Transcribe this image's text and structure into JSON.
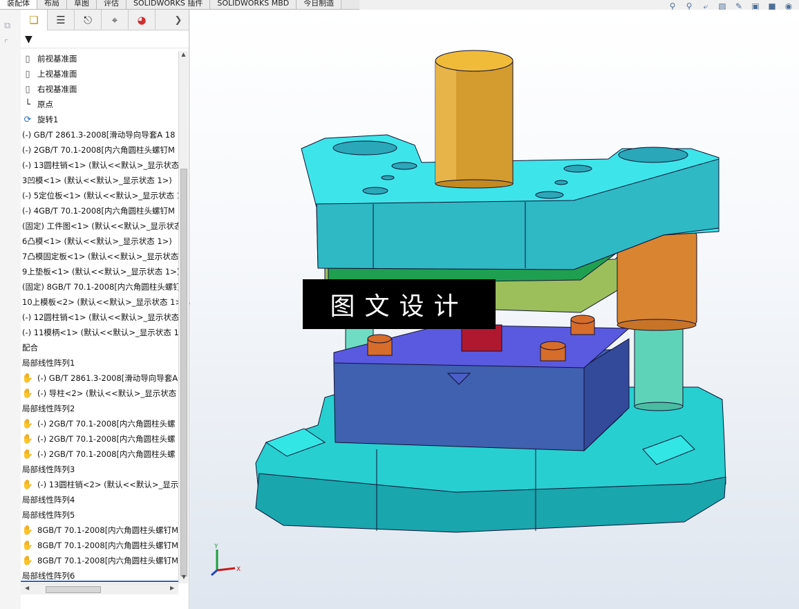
{
  "tabs": [
    {
      "label": "装配体",
      "active": true
    },
    {
      "label": "布局",
      "active": false
    },
    {
      "label": "草图",
      "active": false
    },
    {
      "label": "评估",
      "active": false
    },
    {
      "label": "SOLIDWORKS 插件",
      "active": false
    },
    {
      "label": "SOLIDWORKS MBD",
      "active": false
    },
    {
      "label": "今日制造",
      "active": false
    }
  ],
  "hud_icons": [
    "zoom-to-fit-icon",
    "zoom-area-icon",
    "previous-view-icon",
    "section-view-icon",
    "dynamic-annotation-icon",
    "view-orientation-icon",
    "display-style-icon",
    "hide-show-icon"
  ],
  "feature_manager": {
    "tab_icons": [
      "feature-manager-icon",
      "property-manager-icon",
      "configuration-manager-icon",
      "dimxpert-icon",
      "display-manager-icon"
    ],
    "tree": [
      {
        "icon": "plane",
        "label": "前视基准面"
      },
      {
        "icon": "plane",
        "label": "上视基准面"
      },
      {
        "icon": "plane",
        "label": "右视基准面"
      },
      {
        "icon": "origin",
        "label": "原点"
      },
      {
        "icon": "revolve",
        "label": "旋转1"
      },
      {
        "icon": "",
        "label": "(-) GB/T 2861.3-2008[滑动导向导套A 18"
      },
      {
        "icon": "",
        "label": "(-) 2GB/T 70.1-2008[内六角圆柱头螺钉M"
      },
      {
        "icon": "",
        "label": "(-) 13圆柱销<1> (默认<<默认>_显示状态"
      },
      {
        "icon": "",
        "label": "3凹模<1> (默认<<默认>_显示状态 1>)"
      },
      {
        "icon": "",
        "label": "(-) 5定位板<1> (默认<<默认>_显示状态 1"
      },
      {
        "icon": "",
        "label": "(-) 4GB/T 70.1-2008[内六角圆柱头螺钉M"
      },
      {
        "icon": "",
        "label": "(固定) 工件图<1> (默认<<默认>_显示状态"
      },
      {
        "icon": "",
        "label": "6凸模<1> (默认<<默认>_显示状态 1>)"
      },
      {
        "icon": "",
        "label": "7凸模固定板<1> (默认<<默认>_显示状态"
      },
      {
        "icon": "",
        "label": "9上垫板<1> (默认<<默认>_显示状态 1>)"
      },
      {
        "icon": "",
        "label": "(固定) 8GB/T 70.1-2008[内六角圆柱头螺钉"
      },
      {
        "icon": "",
        "label": "10上模板<2> (默认<<默认>_显示状态 1>)"
      },
      {
        "icon": "",
        "label": "(-) 12圆柱销<1> (默认<<默认>_显示状态"
      },
      {
        "icon": "",
        "label": "(-) 11模柄<1> (默认<<默认>_显示状态 1"
      },
      {
        "icon": "",
        "label": "配合"
      },
      {
        "icon": "",
        "label": "局部线性阵列1"
      },
      {
        "icon": "pattern",
        "label": "(-) GB/T 2861.3-2008[滑动导向导套A"
      },
      {
        "icon": "pattern",
        "label": "(-) 导柱<2> (默认<<默认>_显示状态"
      },
      {
        "icon": "",
        "label": "局部线性阵列2"
      },
      {
        "icon": "pattern",
        "label": "(-) 2GB/T 70.1-2008[内六角圆柱头螺"
      },
      {
        "icon": "pattern",
        "label": "(-) 2GB/T 70.1-2008[内六角圆柱头螺"
      },
      {
        "icon": "pattern",
        "label": "(-) 2GB/T 70.1-2008[内六角圆柱头螺"
      },
      {
        "icon": "",
        "label": "局部线性阵列3"
      },
      {
        "icon": "pattern",
        "label": "(-) 13圆柱销<2> (默认<<默认>_显示"
      },
      {
        "icon": "",
        "label": "局部线性阵列4"
      },
      {
        "icon": "",
        "label": "局部线性阵列5"
      },
      {
        "icon": "pattern",
        "label": "8GB/T 70.1-2008[内六角圆柱头螺钉M"
      },
      {
        "icon": "pattern",
        "label": "8GB/T 70.1-2008[内六角圆柱头螺钉M"
      },
      {
        "icon": "pattern",
        "label": "8GB/T 70.1-2008[内六角圆柱头螺钉M"
      },
      {
        "icon": "",
        "label": "局部线性阵列6"
      }
    ]
  },
  "viewport": {
    "watermark": "图文设计",
    "triad": {
      "y": "Y",
      "x": "X"
    }
  },
  "colors": {
    "die_base": "#2ee6e6",
    "punch_holder": "#7ed957",
    "die_plate": "#3e5fae",
    "stripper": "#5a5ad8",
    "shank": "#d79a28",
    "bushing": "#e08a3a",
    "guide_pillar": "#5fd3b8",
    "punch": "#b01830"
  }
}
